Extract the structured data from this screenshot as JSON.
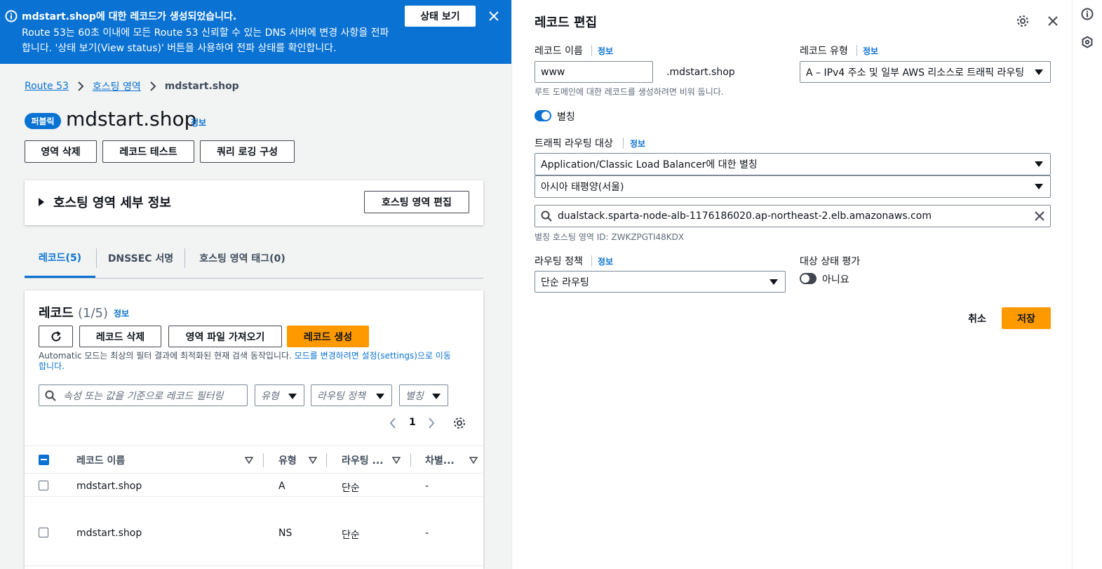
{
  "banner": {
    "title": "mdstart.shop에 대한 레코드가 생성되었습니다.",
    "line1": "Route 53는 60초 이내에 모든 Route 53 신뢰할 수 있는 DNS 서버에 변경 사항을 전파",
    "line2": "합니다. '상태 보기(View status)' 버튼을 사용하여 전파 상태를 확인합니다.",
    "view_status_label": "상태 보기",
    "bg_color": "#0972d3"
  },
  "breadcrumb": {
    "items": [
      "Route 53",
      "호스팅 영역",
      "mdstart.shop"
    ]
  },
  "zone": {
    "badge": "퍼블릭",
    "name": "mdstart.shop",
    "info": "정보",
    "buttons": [
      "영역 삭제",
      "레코드 테스트",
      "쿼리 로깅 구성"
    ],
    "details_title": "호스팅 영역 세부 정보",
    "edit_zone_label": "호스팅 영역 편집"
  },
  "tabs": [
    "레코드(5)",
    "DNSSEC 서명",
    "호스팅 영역 태그(0)"
  ],
  "records": {
    "title": "레코드",
    "count": "(1/5)",
    "info": "정보",
    "delete_label": "레코드 삭제",
    "import_label": "영역 파일 가져오기",
    "create_label": "레코드 생성",
    "auto_note_plain": "Automatic 모드는 최상의 필터 결과에 최적화된 현재 검색 동작입니다. ",
    "auto_note_link1": "모드를 변경하려면 설정(settings)으로 이동",
    "auto_note_link2": "합니다.",
    "search_placeholder": "속성 또는 값을 기준으로 레코드 필터링",
    "filters": [
      "유형",
      "라우팅 정책",
      "별칭"
    ],
    "page": "1",
    "columns": [
      "레코드 이름",
      "유형",
      "라우팅 ...",
      "차별..."
    ],
    "rows": [
      {
        "name": "mdstart.shop",
        "type": "A",
        "routing": "단순",
        "diff": "-"
      },
      {
        "name": "mdstart.shop",
        "type": "NS",
        "routing": "단순",
        "diff": "-"
      }
    ]
  },
  "editor": {
    "title": "레코드 편집",
    "name_label": "레코드 이름",
    "name_info": "정보",
    "name_value": "www",
    "domain_suffix": ".mdstart.shop",
    "name_hint": "루트 도메인에 대한 레코드를 생성하려면 비워 둡니다.",
    "type_label": "레코드 유형",
    "type_info": "정보",
    "type_value": "A – IPv4 주소 및 일부 AWS 리소스로 트래픽 라우팅",
    "alias_label": "별칭",
    "target_label": "트래픽 라우팅 대상",
    "target_info": "정보",
    "target_type": "Application/Classic Load Balancer에 대한 별칭",
    "target_region": "아시아 태평양(서울)",
    "target_value": "dualstack.sparta-node-alb-1176186020.ap-northeast-2.elb.amazonaws.com",
    "zone_id_note": "별칭 호스팅 영역 ID: ZWKZPGTI48KDX",
    "policy_label": "라우팅 정책",
    "policy_info": "정보",
    "policy_value": "단순 라우팅",
    "health_label": "대상 상태 평가",
    "health_value": "아니요",
    "cancel_label": "취소",
    "save_label": "저장"
  },
  "colors": {
    "accent": "#0972d3",
    "primary_button": "#ff9900",
    "page_bg": "#f2f3f3"
  }
}
